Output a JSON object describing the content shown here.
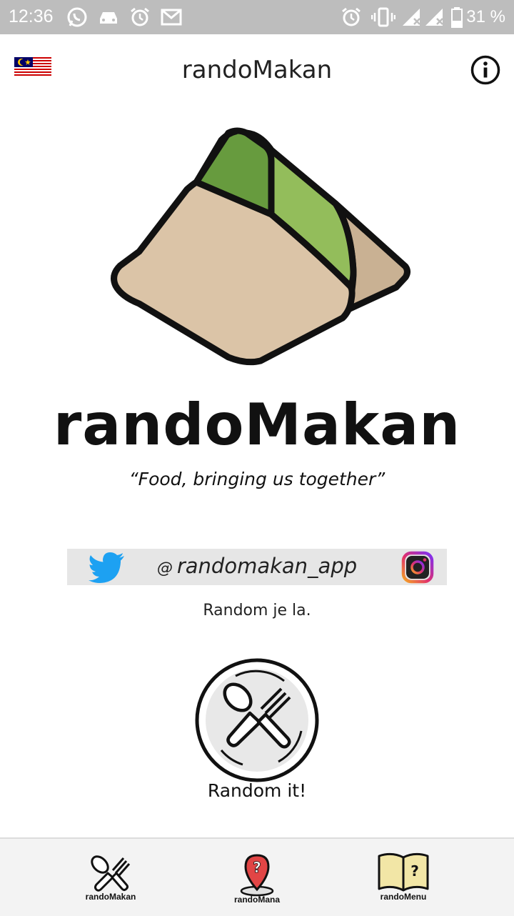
{
  "status_bar": {
    "time": "12:36",
    "battery": "31 %",
    "icons": [
      "whatsapp-icon",
      "car-icon",
      "alarm-icon",
      "gmail-icon",
      "alarm-icon",
      "vibrate-icon",
      "signal-icon",
      "signal-icon",
      "battery-icon"
    ]
  },
  "app_bar": {
    "title": "randoMakan",
    "language_flag": "malaysia-flag-icon",
    "info_icon": "info-icon"
  },
  "hero": {
    "brand": "randoMakan",
    "tagline": "“Food, bringing us together”"
  },
  "social": {
    "handle_prefix": "@",
    "handle": "randomakan_app",
    "icons": [
      "twitter-icon",
      "instagram-icon"
    ]
  },
  "subtext": "Random je la.",
  "random_button": {
    "label": "Random it!",
    "icon": "spoon-fork-icon"
  },
  "bottom_nav": {
    "items": [
      {
        "label": "randoMakan",
        "icon": "spoon-fork-icon"
      },
      {
        "label": "randoMana",
        "icon": "map-pin-question-icon"
      },
      {
        "label": "randoMenu",
        "icon": "book-question-icon"
      }
    ]
  },
  "colors": {
    "status_bar": "#bdbdbd",
    "leaf_dark": "#679b3e",
    "leaf_light": "#93bd5b",
    "rice": "#dbc4a7",
    "rice_shadow": "#c9b193",
    "nav_bg": "#f3f3f3",
    "twitter": "#1da1f2"
  }
}
